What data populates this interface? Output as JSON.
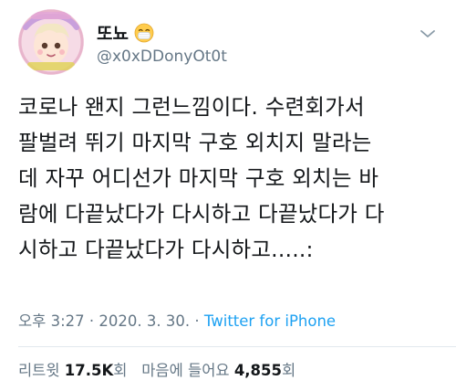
{
  "user": {
    "display_name": "또뇨",
    "handle": "@x0xDDonyOt0t",
    "avatar_icon": "anime-avatar-icon",
    "emoji_icon": "face-with-mask-emoji-icon"
  },
  "tweet": {
    "text": "코로나 왠지 그런느낌이다. 수련회가서\n팔벌려 뛰기 마지막 구호 외치지 말라는\n데 자꾸 어디선가 마지막 구호 외치는 바\n람에 다끝났다가 다시하고 다끝났다가 다\n시하고 다끝났다가 다시하고.....:",
    "time": "오후 3:27",
    "date": "2020. 3. 30.",
    "separator": "·",
    "source": "Twitter for iPhone"
  },
  "stats": {
    "retweets_label": "리트윗",
    "retweets_value": "17.5K",
    "retweets_unit": "회",
    "likes_label": "마음에 들어요",
    "likes_value": "4,855",
    "likes_unit": "회"
  },
  "colors": {
    "text": "#14171a",
    "muted": "#657786",
    "link": "#1da1f2",
    "divider": "#e1e8ed"
  }
}
